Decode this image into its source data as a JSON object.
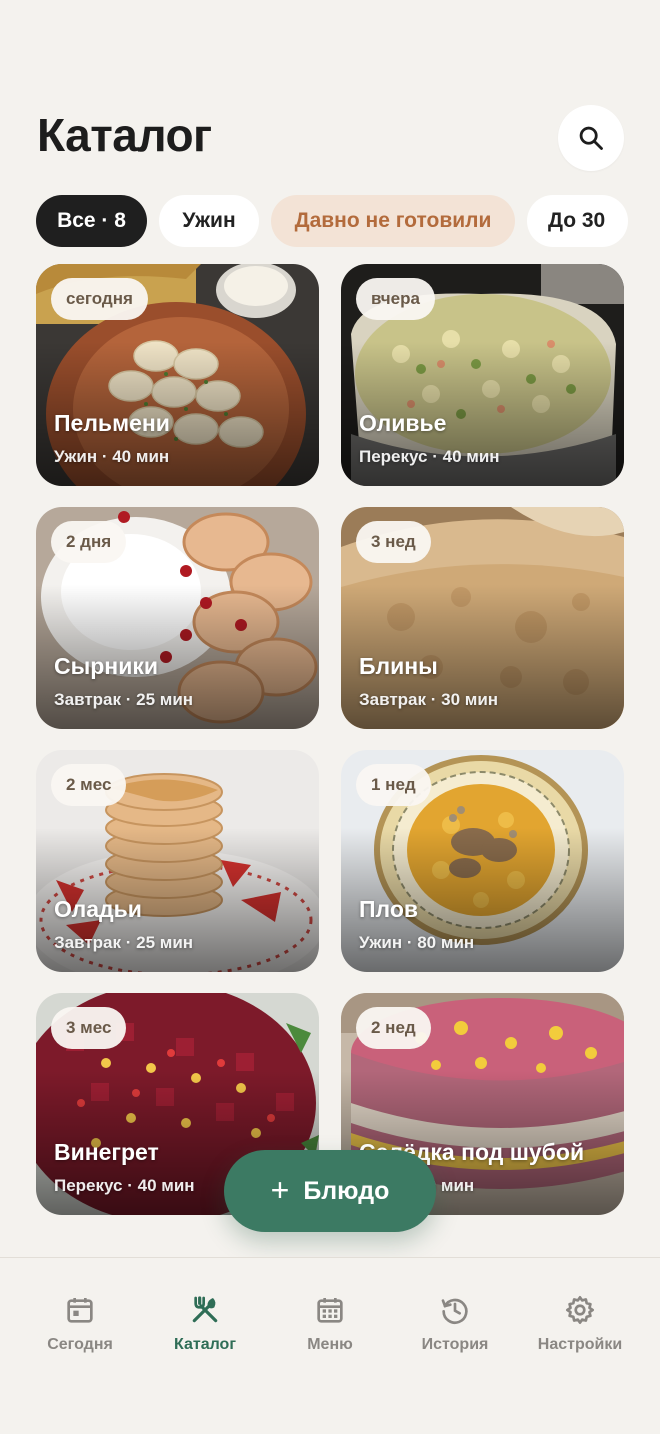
{
  "header": {
    "title": "Каталог"
  },
  "search": {
    "icon": "search-icon"
  },
  "filters": [
    {
      "label": "Все · 8",
      "active": true
    },
    {
      "label": "Ужин",
      "active": false
    },
    {
      "label": "Давно не готовили",
      "active": false
    },
    {
      "label": "До 30",
      "active": false
    }
  ],
  "dishes": [
    {
      "badge": "сегодня",
      "name": "Пельмени",
      "meta": "Ужин · 40 мин"
    },
    {
      "badge": "вчера",
      "name": "Оливье",
      "meta": "Перекус · 40 мин"
    },
    {
      "badge": "2 дня",
      "name": "Сырники",
      "meta": "Завтрак · 25 мин"
    },
    {
      "badge": "3 нед",
      "name": "Блины",
      "meta": "Завтрак · 30 мин"
    },
    {
      "badge": "2 мес",
      "name": "Оладьи",
      "meta": "Завтрак · 25 мин"
    },
    {
      "badge": "1 нед",
      "name": "Плов",
      "meta": "Ужин · 80 мин"
    },
    {
      "badge": "3 мес",
      "name": "Винегрет",
      "meta": "Перекус · 40 мин"
    },
    {
      "badge": "2 нед",
      "name": "Селёдка под шубой",
      "meta": "Ужин · 60 мин"
    }
  ],
  "fab": {
    "plus": "+",
    "label": "Блюдо"
  },
  "tabs": [
    {
      "label": "Сегодня",
      "icon": "calendar-day-icon",
      "active": false
    },
    {
      "label": "Каталог",
      "icon": "utensils-icon",
      "active": true
    },
    {
      "label": "Меню",
      "icon": "calendar-grid-icon",
      "active": false
    },
    {
      "label": "История",
      "icon": "history-icon",
      "active": false
    },
    {
      "label": "Настройки",
      "icon": "gear-icon",
      "active": false
    }
  ],
  "colors": {
    "accent": "#3c7a63",
    "background": "#f4f2ee",
    "chip_dark": "#1f1f1f",
    "chip_highlight": "#f3e3d6"
  }
}
